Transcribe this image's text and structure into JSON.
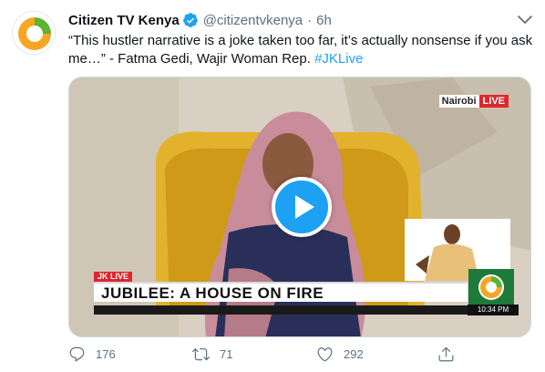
{
  "tweet": {
    "display_name": "Citizen TV Kenya",
    "handle": "@citizentvkenya",
    "separator": "·",
    "time": "6h",
    "text_main": "“This hustler narrative is a joke taken too far, it’s actually nonsense if you ask me…” - Fatma Gedi, Wajir Woman Rep. ",
    "hashtag": "#JKLive"
  },
  "media": {
    "location_label": "Nairobi",
    "live_label": "LIVE",
    "tag_label": "JK LIVE",
    "headline": "JUBILEE: A HOUSE ON FIRE",
    "clock": "10:34 PM"
  },
  "actions": {
    "reply_count": "176",
    "retweet_count": "71",
    "like_count": "292"
  },
  "colors": {
    "accent": "#1da1f2",
    "muted": "#5b7083",
    "live_red": "#e0262c",
    "brand_orange": "#f5a623",
    "brand_green": "#5bb531"
  },
  "icons": {
    "verified": "verified-badge-icon",
    "caret": "chevron-down-icon",
    "play": "play-icon",
    "reply": "reply-icon",
    "retweet": "retweet-icon",
    "like": "heart-icon",
    "share": "share-icon"
  }
}
